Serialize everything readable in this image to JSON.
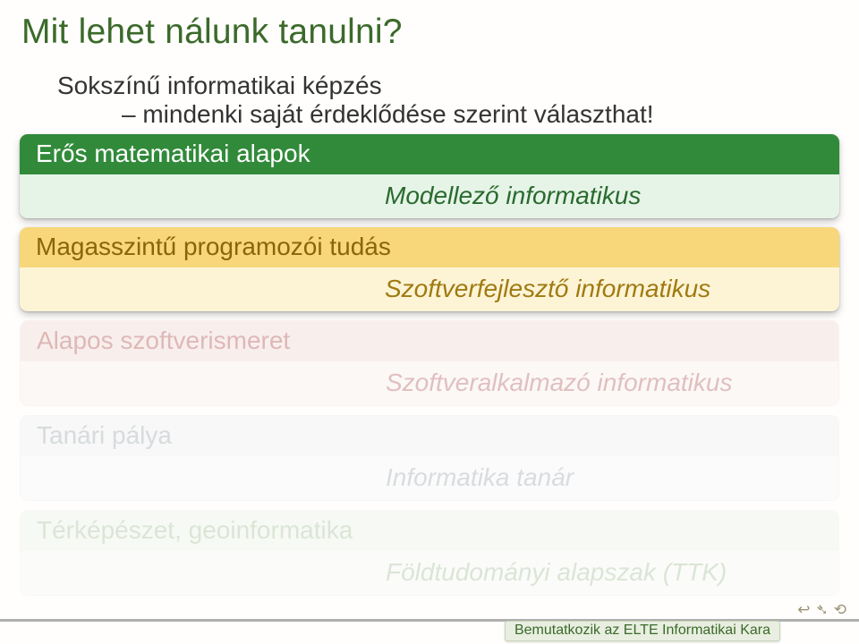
{
  "title": "Mit lehet nálunk tanulni?",
  "intro": {
    "line1": "Sokszínű informatikai képzés",
    "line2": "– mindenki saját érdeklődése szerint választhat!"
  },
  "blocks": [
    {
      "id": "math",
      "variant": "green",
      "head": "Erős matematikai alapok",
      "body": "Modellező informatikus"
    },
    {
      "id": "prog",
      "variant": "yellow",
      "head": "Magasszintű programozói tudás",
      "body": "Szoftverfejlesztő informatikus"
    },
    {
      "id": "softk",
      "variant": "pink",
      "head": "Alapos szoftverismeret",
      "body": "Szoftveralkalmazó informatikus"
    },
    {
      "id": "teacher",
      "variant": "fadeblue",
      "head": "Tanári pálya",
      "body": "Informatika tanár"
    },
    {
      "id": "geo",
      "variant": "fadegreen",
      "head": "Térképészet, geoinformatika",
      "body": "Földtudományi alapszak (TTK)"
    }
  ],
  "footer": {
    "title": "Bemutatkozik az ELTE Informatikai Kara"
  },
  "nav": {
    "back": "↩",
    "search": "➴",
    "restart": "⟲"
  }
}
